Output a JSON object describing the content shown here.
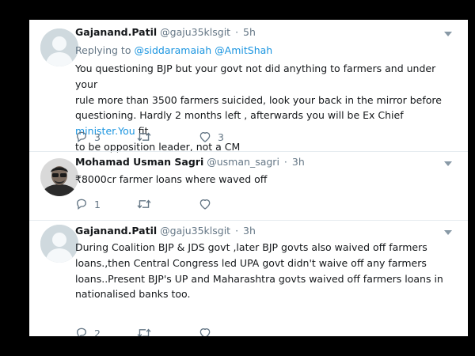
{
  "tweets": [
    {
      "name": "Gajanand.Patil",
      "handle": "@gaju35klsgit",
      "dot": "·",
      "time": "5h",
      "replying_prefix": "Replying to",
      "mention_1": "@siddaramaiah",
      "mention_2": "@AmitShah",
      "line_1": "You questioning BJP but your govt not did anything to farmers and under your",
      "line_2": "rule more than 3500 farmers suicided, look your back in the mirror before",
      "line_3_text": "questioning. Hardly 2 months left , afterwards you will be Ex Chief ",
      "line_3_link": "minister.You",
      "line_3_tail": " fit",
      "line_4": "to be opposition leader, not a CM",
      "replies": "3",
      "likes": "3"
    },
    {
      "name": "Mohamad Usman Sagri",
      "handle": "@usman_sagri",
      "dot": "·",
      "time": "3h",
      "line_1": "₹8000cr farmer loans where waved off",
      "replies": "1"
    },
    {
      "name": "Gajanand.Patil",
      "handle": "@gaju35klsgit",
      "dot": "·",
      "time": "3h",
      "line_1": "During Coalition BJP & JDS govt ,later BJP govts also waived off farmers",
      "line_2": "loans.,then Central Congress led UPA govt didn't waive off any farmers",
      "line_3": "loans..Present BJP's UP and Maharashtra govts waived off farmers loans in",
      "line_4": "nationalised banks too.",
      "replies": "2"
    }
  ],
  "colors": {
    "accent": "#1b95e0",
    "secondary_text": "#657786",
    "icon": "#657786"
  },
  "icons": [
    "reply-icon",
    "retweet-icon",
    "like-icon",
    "caret-down-icon"
  ]
}
